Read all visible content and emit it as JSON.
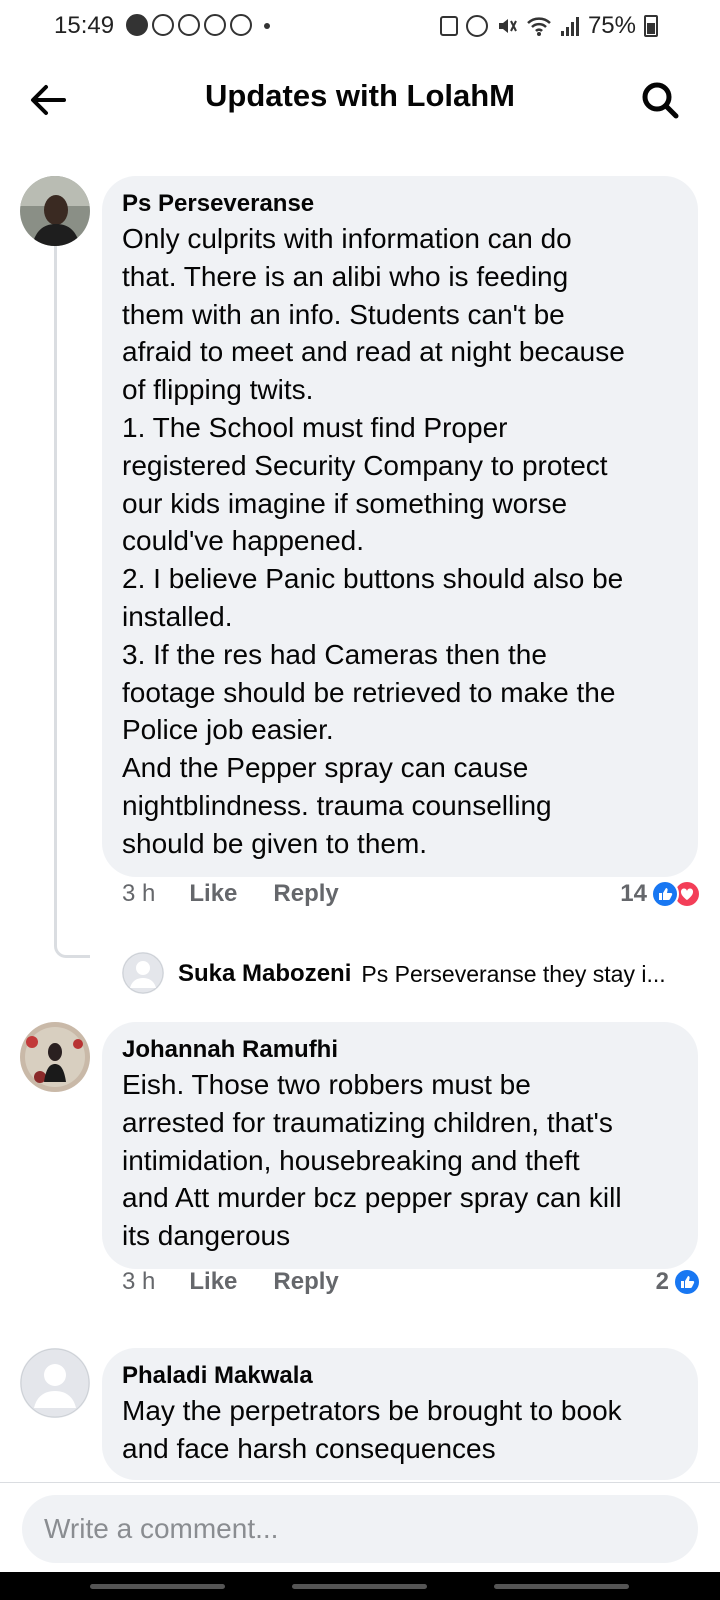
{
  "status_bar": {
    "time": "15:49",
    "battery": "75%"
  },
  "header": {
    "title": "Updates with LolahM",
    "back_icon": "arrow-left-icon",
    "search_icon": "search-icon"
  },
  "comments": [
    {
      "author": "Ps Perseveranse",
      "text": "Only culprits with information can do\nthat. There is an alibi who is feeding\nthem with an info. Students can't be\nafraid to meet and read at night because\nof flipping twits.\n1. The School must find Proper\nregistered Security Company to protect\nour kids imagine if something worse\ncould've happened.\n2. I believe Panic buttons should also be\ninstalled.\n3. If the res had Cameras then the\nfootage should be retrieved to make the\nPolice job easier.\nAnd the Pepper spray can cause\nnightblindness. trauma counselling\nshould be given to them.",
      "time": "3 h",
      "like_label": "Like",
      "reply_label": "Reply",
      "reaction_count": "14",
      "reactions": [
        "like",
        "love"
      ],
      "reply_preview": {
        "author": "Suka Mabozeni",
        "text": "Ps Perseveranse they stay i..."
      }
    },
    {
      "author": "Johannah Ramufhi",
      "text": "Eish. Those two robbers must be\narrested for traumatizing children, that's\nintimidation, housebreaking and theft\nand Att murder bcz pepper spray can kill\nits dangerous",
      "time": "3 h",
      "like_label": "Like",
      "reply_label": "Reply",
      "reaction_count": "2",
      "reactions": [
        "like"
      ]
    },
    {
      "author": "Phaladi Makwala",
      "text": "May the perpetrators be brought to book\nand face harsh consequences"
    }
  ],
  "composer": {
    "placeholder": "Write a comment..."
  },
  "colors": {
    "bubble": "#f0f2f5",
    "meta_text": "#65676b",
    "like_blue": "#1877f2",
    "love_red": "#f33e58"
  }
}
